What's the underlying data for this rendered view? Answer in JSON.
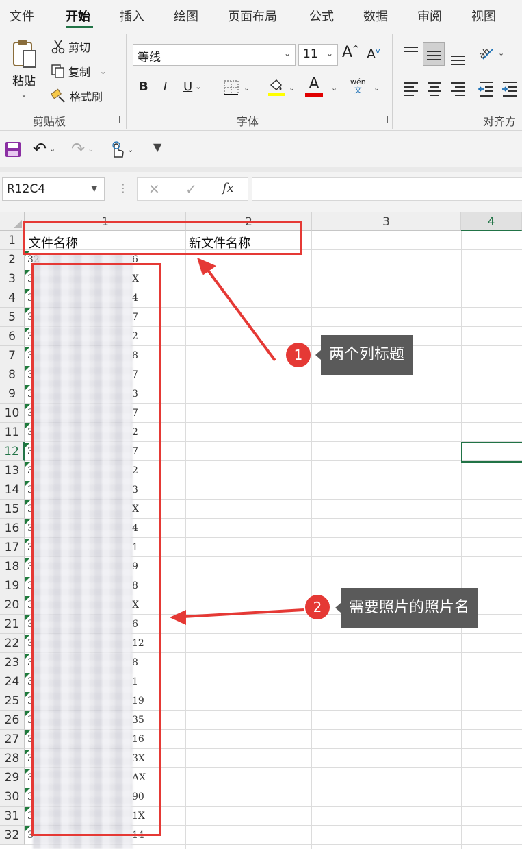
{
  "tabs": [
    "文件",
    "开始",
    "插入",
    "绘图",
    "页面布局",
    "公式",
    "数据",
    "审阅",
    "视图"
  ],
  "clipboard": {
    "paste": "粘贴",
    "cut": "剪切",
    "copy": "复制",
    "format_painter": "格式刷",
    "group_label": "剪贴板"
  },
  "font": {
    "name": "等线",
    "size": "11",
    "group_label": "字体",
    "grow": "A",
    "shrink": "A",
    "bold": "B",
    "italic": "I",
    "underline": "U",
    "font_color": "A",
    "phonetic_top": "wén",
    "phonetic_bottom": "文"
  },
  "alignment": {
    "group_label": "对齐方"
  },
  "name_box": "R12C4",
  "formula_label": "fx",
  "columns": [
    "1",
    "2",
    "3",
    "4"
  ],
  "rows": [
    "1",
    "2",
    "3",
    "4",
    "5",
    "6",
    "7",
    "8",
    "9",
    "10",
    "11",
    "12",
    "13",
    "14",
    "15",
    "16",
    "17",
    "18",
    "19",
    "20",
    "21",
    "22",
    "23",
    "24",
    "25",
    "26",
    "27",
    "28",
    "29",
    "30",
    "31",
    "32"
  ],
  "header_row": {
    "col1": "文件名称",
    "col2": "新文件名称"
  },
  "obscured_leading": [
    "32",
    "3",
    "3",
    "3",
    "3",
    "3",
    "3",
    "3",
    "3",
    "3",
    "3",
    "3",
    "3",
    "3",
    "3",
    "3",
    "3",
    "3",
    "3",
    "3",
    "3",
    "3",
    "3",
    "3",
    "3",
    "3",
    "3",
    "3",
    "3",
    "3",
    "3"
  ],
  "obscured_trailing": [
    "6",
    "X",
    "4",
    "7",
    "2",
    "8",
    "7",
    "3",
    "7",
    "2",
    "7",
    "2",
    "3",
    "X",
    "4",
    "1",
    "9",
    "8",
    "X",
    "6",
    "12",
    "8",
    "1",
    "19",
    "35",
    "16",
    "3X",
    "AX",
    "90",
    "1X",
    "14"
  ],
  "annotations": [
    {
      "number": "1",
      "text": "两个列标题"
    },
    {
      "number": "2",
      "text": "需要照片的照片名"
    }
  ],
  "colors": {
    "accent_green": "#217346",
    "annotation_red": "#e53935",
    "callout_gray": "#5a5a5a"
  }
}
